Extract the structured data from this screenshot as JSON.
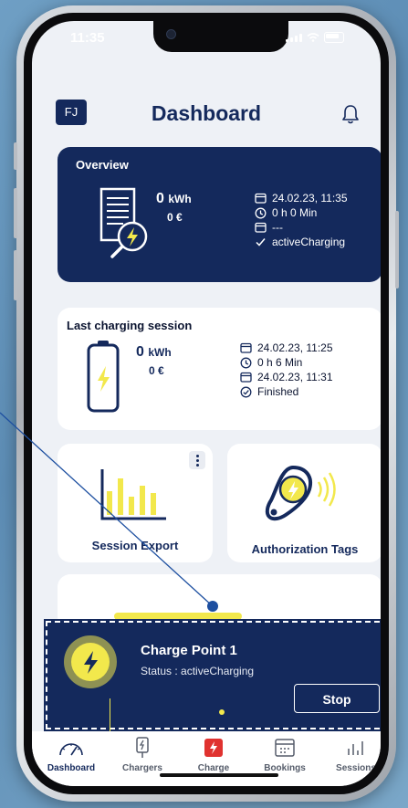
{
  "status_bar": {
    "time": "11:35"
  },
  "header": {
    "avatar_initials": "FJ",
    "title": "Dashboard",
    "bell_icon": "bell-icon"
  },
  "overview": {
    "title": "Overview",
    "energy_value": "0",
    "energy_unit": "kWh",
    "cost": "0 €",
    "date": "24.02.23, 11:35",
    "duration": "0 h 0 Min",
    "end": "---",
    "status": "activeCharging"
  },
  "last_session": {
    "title": "Last charging session",
    "energy_value": "0",
    "energy_unit": "kWh",
    "cost": "0 €",
    "start": "24.02.23, 11:25",
    "duration": "0 h 6 Min",
    "end": "24.02.23, 11:31",
    "status": "Finished"
  },
  "tiles": [
    {
      "label": "Session Export",
      "icon": "bar-chart-icon"
    },
    {
      "label": "Authorization Tags",
      "icon": "rfid-tag-icon"
    }
  ],
  "charge_point": {
    "name": "Charge Point 1",
    "status": "Status : activeCharging",
    "stop_label": "Stop"
  },
  "tabbar": [
    {
      "label": "Dashboard",
      "icon": "gauge-icon",
      "active": true
    },
    {
      "label": "Chargers",
      "icon": "charger-icon",
      "active": false
    },
    {
      "label": "Charge",
      "icon": "charge-bolt-icon",
      "active": false
    },
    {
      "label": "Bookings",
      "icon": "calendar-icon",
      "active": false
    },
    {
      "label": "Sessions",
      "icon": "sessions-chart-icon",
      "active": false
    }
  ],
  "colors": {
    "primary": "#14295c",
    "accent": "#f2e84c",
    "charge_red": "#e0322f",
    "background": "#eef1f6"
  }
}
